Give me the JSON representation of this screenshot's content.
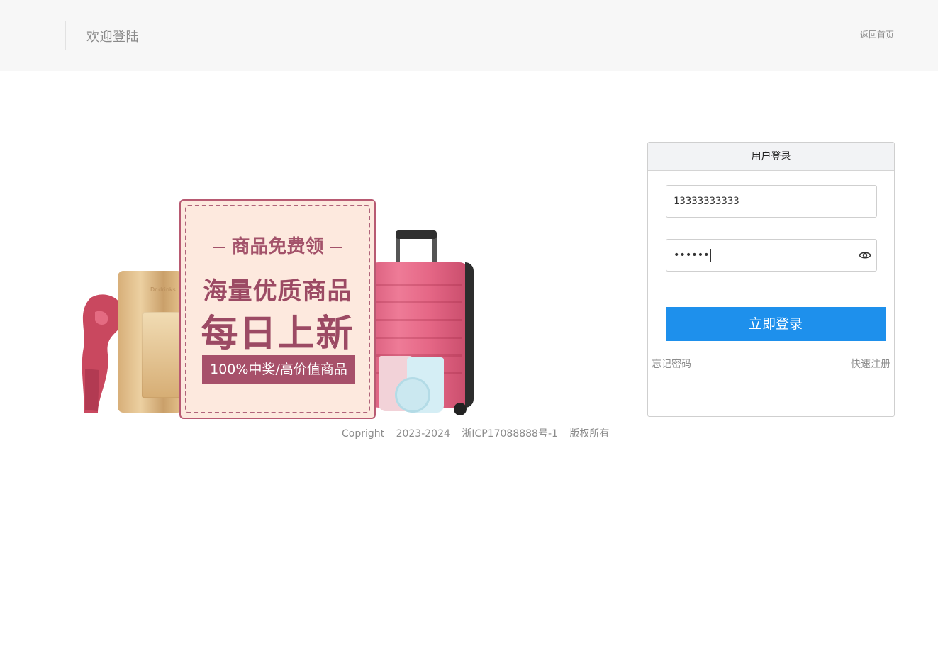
{
  "header": {
    "welcome_text": "欢迎登陆",
    "home_link": "返回首页"
  },
  "promo": {
    "subtitle": "商品免费领",
    "headline_1": "海量优质商品",
    "headline_2": "每日上新",
    "tag": "100%中奖/高价值商品",
    "box_brand": "Dr.drinks"
  },
  "footer": {
    "copyright": "Copright",
    "years": "2023-2024",
    "icp": "浙ICP17088888号-1",
    "rights": "版权所有"
  },
  "login": {
    "title": "用户登录",
    "phone_value": "13333333333",
    "password_mask": "••••••",
    "submit_label": "立即登录",
    "forgot_label": "忘记密码",
    "register_label": "快速注册"
  },
  "colors": {
    "accent": "#1e90ec",
    "promo_primary": "#a3526a",
    "promo_bg": "#fde9de"
  },
  "icons": [
    "eye-icon"
  ]
}
